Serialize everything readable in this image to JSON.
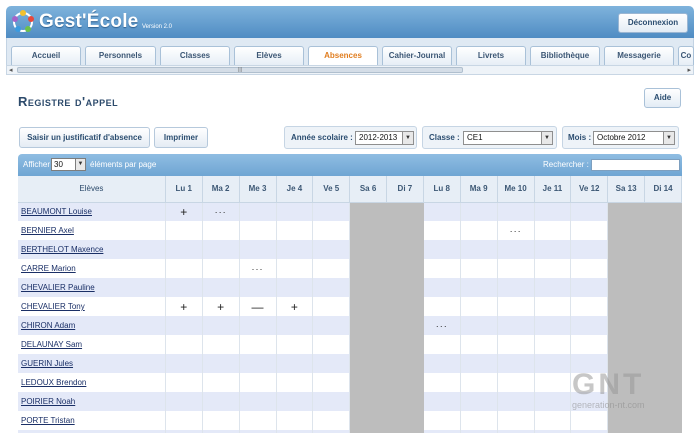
{
  "app": {
    "title": "Gest'École",
    "version": "Version 2.0",
    "logout_label": "Déconnexion"
  },
  "tabs": [
    {
      "label": "Accueil",
      "active": false
    },
    {
      "label": "Personnels",
      "active": false
    },
    {
      "label": "Classes",
      "active": false
    },
    {
      "label": "Elèves",
      "active": false
    },
    {
      "label": "Absences",
      "active": true
    },
    {
      "label": "Cahier-Journal",
      "active": false
    },
    {
      "label": "Livrets",
      "active": false
    },
    {
      "label": "Bibliothèque",
      "active": false
    },
    {
      "label": "Messagerie",
      "active": false
    },
    {
      "label": "Co",
      "active": false
    }
  ],
  "page": {
    "title": "Registre d'appel",
    "help_label": "Aide"
  },
  "toolbar": {
    "justify_label": "Saisir un justificatif d'absence",
    "print_label": "Imprimer",
    "year_label": "Année scolaire :",
    "year_value": "2012-2013",
    "class_label": "Classe :",
    "class_value": "CE1",
    "month_label": "Mois :",
    "month_value": "Octobre 2012"
  },
  "table_controls": {
    "show_label": "Afficher",
    "per_page_value": "30",
    "per_page_suffix": "éléments par page",
    "search_label": "Rechercher :"
  },
  "grid": {
    "name_header": "Elèves",
    "days": [
      {
        "label": "Lu 1",
        "weekend": false
      },
      {
        "label": "Ma 2",
        "weekend": false
      },
      {
        "label": "Me 3",
        "weekend": false
      },
      {
        "label": "Je 4",
        "weekend": false
      },
      {
        "label": "Ve 5",
        "weekend": false
      },
      {
        "label": "Sa 6",
        "weekend": true
      },
      {
        "label": "Di 7",
        "weekend": true
      },
      {
        "label": "Lu 8",
        "weekend": false
      },
      {
        "label": "Ma 9",
        "weekend": false
      },
      {
        "label": "Me 10",
        "weekend": false
      },
      {
        "label": "Je 11",
        "weekend": false
      },
      {
        "label": "Ve 12",
        "weekend": false
      },
      {
        "label": "Sa 13",
        "weekend": true
      },
      {
        "label": "Di 14",
        "weekend": true
      }
    ],
    "rows": [
      {
        "name": "BEAUMONT Louise",
        "marks": [
          "+",
          "···",
          "",
          "",
          "",
          "",
          "",
          "",
          "",
          "",
          "",
          "",
          "",
          ""
        ]
      },
      {
        "name": "BERNIER Axel",
        "marks": [
          "",
          "",
          "",
          "",
          "",
          "",
          "",
          "",
          "",
          "···",
          "",
          "",
          "",
          ""
        ]
      },
      {
        "name": "BERTHELOT Maxence",
        "marks": [
          "",
          "",
          "",
          "",
          "",
          "",
          "",
          "",
          "",
          "",
          "",
          "",
          "",
          ""
        ]
      },
      {
        "name": "CARRE Marion",
        "marks": [
          "",
          "",
          "···",
          "",
          "",
          "",
          "",
          "",
          "",
          "",
          "",
          "",
          "",
          ""
        ]
      },
      {
        "name": "CHEVALIER Pauline",
        "marks": [
          "",
          "",
          "",
          "",
          "",
          "",
          "",
          "",
          "",
          "",
          "",
          "",
          "",
          ""
        ]
      },
      {
        "name": "CHEVALIER Tony",
        "marks": [
          "+",
          "+",
          "—",
          "+",
          "",
          "",
          "",
          "",
          "",
          "",
          "",
          "",
          "",
          ""
        ]
      },
      {
        "name": "CHIRON Adam",
        "marks": [
          "",
          "",
          "",
          "",
          "",
          "",
          "",
          "···",
          "",
          "",
          "",
          "",
          "",
          ""
        ]
      },
      {
        "name": "DELAUNAY Sam",
        "marks": [
          "",
          "",
          "",
          "",
          "",
          "",
          "",
          "",
          "",
          "",
          "",
          "",
          "",
          ""
        ]
      },
      {
        "name": "GUERIN Jules",
        "marks": [
          "",
          "",
          "",
          "",
          "",
          "",
          "",
          "",
          "",
          "",
          "",
          "",
          "",
          ""
        ]
      },
      {
        "name": "LEDOUX Brendon",
        "marks": [
          "",
          "",
          "",
          "",
          "",
          "",
          "",
          "",
          "",
          "",
          "",
          "",
          "",
          ""
        ]
      },
      {
        "name": "POIRIER Noah",
        "marks": [
          "",
          "",
          "",
          "",
          "",
          "",
          "",
          "",
          "",
          "",
          "",
          "",
          "",
          ""
        ]
      },
      {
        "name": "PORTE Tristan",
        "marks": [
          "",
          "",
          "",
          "",
          "",
          "",
          "",
          "",
          "",
          "",
          "",
          "",
          "",
          ""
        ]
      },
      {
        "name": "",
        "marks": [
          "",
          "",
          "",
          "",
          "",
          "",
          "",
          "",
          "",
          "",
          "",
          "",
          "",
          ""
        ]
      }
    ]
  },
  "watermark": {
    "big": "GNT",
    "small": "generation-nt.com"
  },
  "colors": {
    "header": "#4f8cc3",
    "accent": "#e07d1f",
    "row_alt": "#e4e9f8",
    "weekend": "#bdbdbd"
  }
}
